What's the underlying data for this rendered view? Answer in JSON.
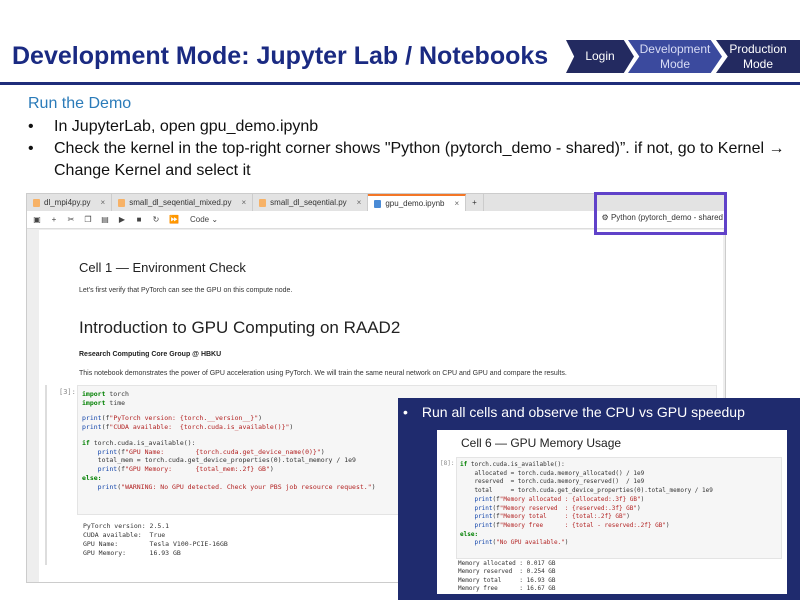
{
  "slide": {
    "title": "Development Mode: Jupyter Lab / Notebooks",
    "steps": [
      {
        "label": "Login"
      },
      {
        "label": "Development\nMode"
      },
      {
        "label": "Production\nMode"
      }
    ],
    "subheading": "Run the Demo",
    "bullets": [
      "In JupyterLab, open gpu_demo.ipynb",
      "Check the kernel in the top-right corner shows \"Python (pytorch_demo - shared)”. if not, go to Kernel → Change Kernel and select it"
    ],
    "bullet_glyph": "•"
  },
  "jupyter": {
    "tabs": [
      {
        "label": "dl_mpi4py.py",
        "icon": "python-file-icon"
      },
      {
        "label": "small_dl_seqential_mixed.py",
        "icon": "python-file-icon"
      },
      {
        "label": "small_dl_seqential.py",
        "icon": "python-file-icon"
      },
      {
        "label": "gpu_demo.ipynb",
        "icon": "notebook-file-icon",
        "active": true
      }
    ],
    "new_tab": "+",
    "tab_close": "×",
    "cell_type": "Code",
    "kernel": "Python (pytorch_demo - shared",
    "cell1_heading": "Cell 1 — Environment Check",
    "cell1_text": "Let's first verify that PyTorch can see the GPU on this compute node.",
    "intro_heading": "Introduction to GPU Computing on RAAD2",
    "group": "Research Computing Core Group @ HBKU",
    "demo_text": "This notebook demonstrates the power of GPU acceleration using PyTorch. We will train the same neural network on CPU and GPU and compare the results.",
    "prompt1": "[3]:",
    "code1": [
      "import torch",
      "import time",
      "",
      "print(f\"PyTorch version: {torch.__version__}\")",
      "print(f\"CUDA available:  {torch.cuda.is_available()}\")",
      "",
      "if torch.cuda.is_available():",
      "    print(f\"GPU Name:        {torch.cuda.get_device_name(0)}\")",
      "    total_mem = torch.cuda.get_device_properties(0).total_memory / 1e9",
      "    print(f\"GPU Memory:      {total_mem:.2f} GB\")",
      "else:",
      "    print(\"WARNING: No GPU detected. Check your PBS job resource request.\")"
    ],
    "output1": [
      "PyTorch version: 2.5.1",
      "CUDA available:  True",
      "GPU Name:        Tesla V100-PCIE-16GB",
      "GPU Memory:      16.93 GB"
    ]
  },
  "overlay": {
    "bullet": "Run all cells and observe the CPU vs GPU speedup",
    "cell6_heading": "Cell 6 — GPU Memory Usage",
    "prompt8": "[8]:",
    "code8": [
      "if torch.cuda.is_available():",
      "    allocated = torch.cuda.memory_allocated() / 1e9",
      "    reserved  = torch.cuda.memory_reserved()  / 1e9",
      "    total     = torch.cuda.get_device_properties(0).total_memory / 1e9",
      "    print(f\"Memory allocated : {allocated:.3f} GB\")",
      "    print(f\"Memory reserved  : {reserved:.3f} GB\")",
      "    print(f\"Memory total     : {total:.2f} GB\")",
      "    print(f\"Memory free      : {total - reserved:.2f} GB\")",
      "else:",
      "    print(\"No GPU available.\")"
    ],
    "output8": [
      "Memory allocated : 0.017 GB",
      "Memory reserved  : 0.254 GB",
      "Memory total     : 16.93 GB",
      "Memory free      : 16.67 GB"
    ]
  },
  "colors": {
    "title": "#1a2a82",
    "accent_blue": "#2b7bb9",
    "highlight_box": "#6042c9",
    "overlay_bg": "#1f2b6e"
  }
}
